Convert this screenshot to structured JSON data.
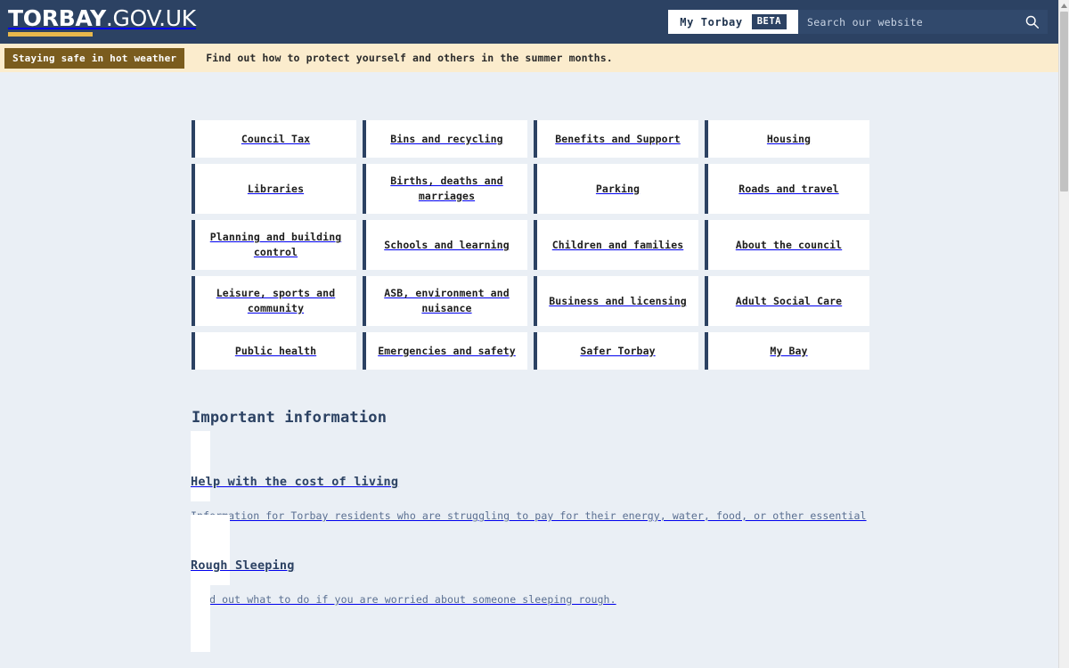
{
  "header": {
    "brand_bold": "TORBAY",
    "brand_rest": ".GOV.UK",
    "mytorbay_label": "My Torbay",
    "beta_label": "BETA",
    "search_placeholder": "Search our website",
    "search_value": "",
    "search_icon": "search-icon",
    "colors": {
      "navy": "#2c4263",
      "gold": "#e8b84b",
      "search_field": "#31496c"
    }
  },
  "alert": {
    "badge": "Staying safe in hot weather",
    "message": "Find out how to protect yourself and others in the summer months.",
    "colors": {
      "background": "#fbeccd",
      "badge_background": "#7a5c1e"
    }
  },
  "nav_cards": [
    {
      "label": "Council Tax"
    },
    {
      "label": "Bins and recycling"
    },
    {
      "label": "Benefits and Support"
    },
    {
      "label": "Housing"
    },
    {
      "label": "Libraries"
    },
    {
      "label": "Births, deaths and marriages"
    },
    {
      "label": "Parking"
    },
    {
      "label": "Roads and travel"
    },
    {
      "label": "Planning and building control"
    },
    {
      "label": "Schools and learning"
    },
    {
      "label": "Children and families"
    },
    {
      "label": "About the council"
    },
    {
      "label": "Leisure, sports and community"
    },
    {
      "label": "ASB, environment and nuisance"
    },
    {
      "label": "Business and licensing"
    },
    {
      "label": "Adult Social Care"
    },
    {
      "label": "Public health"
    },
    {
      "label": "Emergencies and safety"
    },
    {
      "label": "Safer Torbay"
    },
    {
      "label": "My Bay"
    }
  ],
  "important_information": {
    "heading": "Important information",
    "items": [
      {
        "title": "Help with the cost of living",
        "description": "Information for Torbay residents who are struggling to pay for their energy, water, food, or other essential items."
      },
      {
        "title": "Rough Sleeping",
        "description": "Find out what to do if you are worried about someone sleeping rough."
      }
    ]
  },
  "scrollbar": {
    "up_arrow_icon": "triangle-up-icon"
  }
}
